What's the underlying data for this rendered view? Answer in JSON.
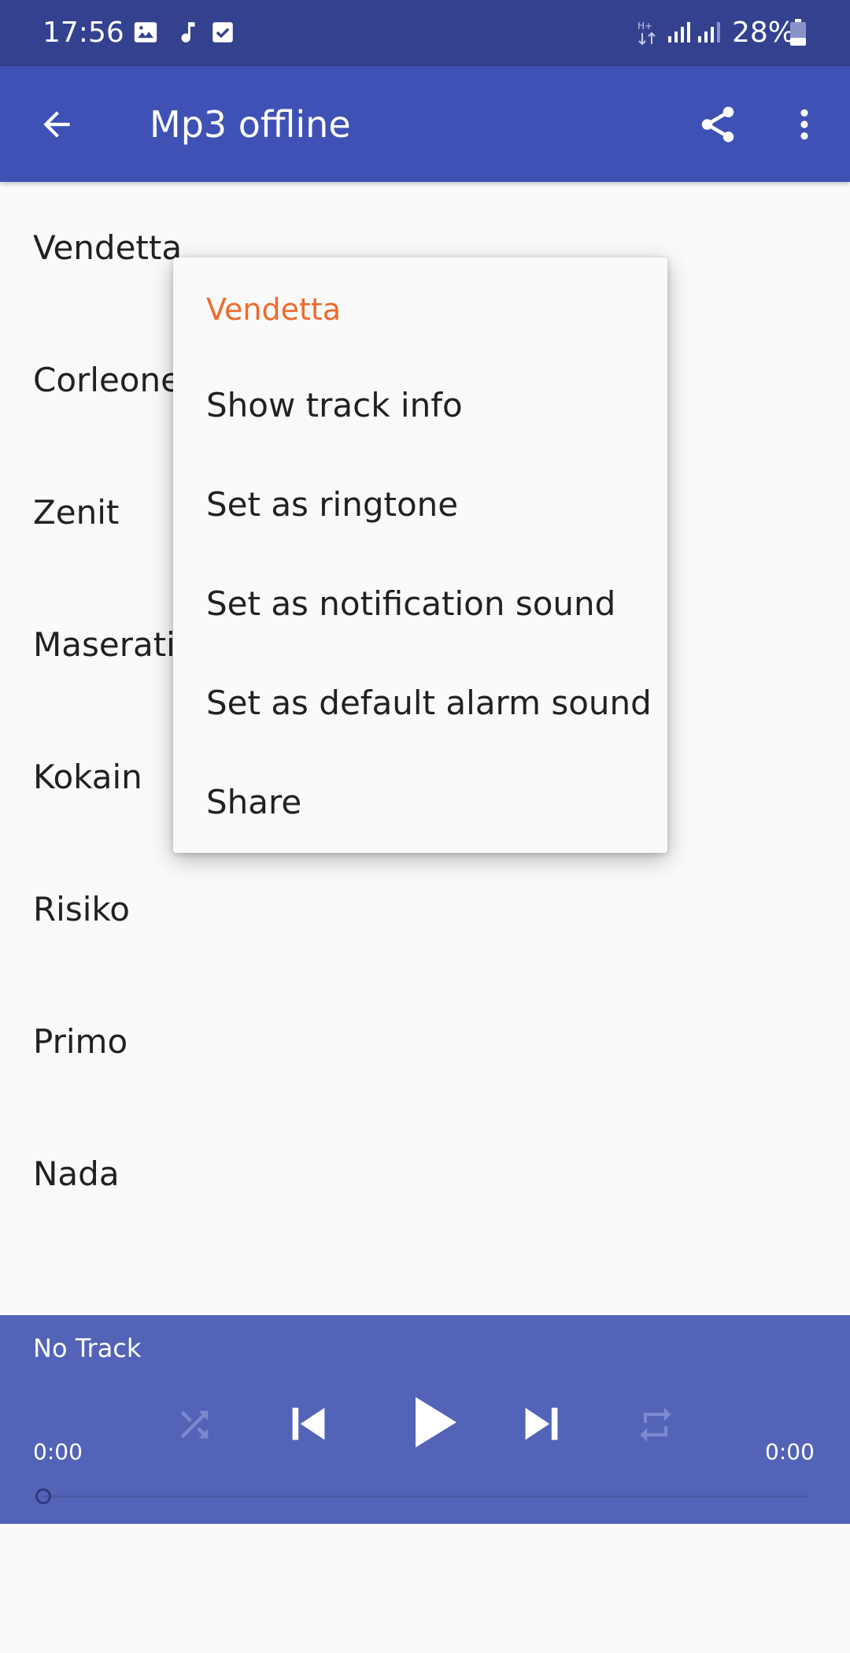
{
  "status_bar": {
    "time": "17:56",
    "battery": "28%",
    "icons": [
      "image-icon",
      "music-note-icon",
      "checkbox-icon",
      "data-hplus-icon",
      "signal-icon",
      "signal-icon",
      "battery-icon"
    ]
  },
  "app_bar": {
    "title": "Mp3 offline",
    "icons": [
      "back-arrow-icon",
      "share-icon",
      "more-vert-icon"
    ]
  },
  "tracks": [
    "Vendetta",
    "Corleone",
    "Zenit",
    "Maserati",
    "Kokain",
    "Risiko",
    "Primo",
    "Nada"
  ],
  "context_menu": {
    "title": "Vendetta",
    "items": [
      "Show track info",
      "Set as ringtone",
      "Set as notification sound",
      "Set as default alarm sound",
      "Share"
    ]
  },
  "player": {
    "now_playing": "No Track",
    "elapsed": "0:00",
    "duration": "0:00",
    "progress": 0,
    "icons": [
      "shuffle-icon",
      "skip-previous-icon",
      "play-icon",
      "skip-next-icon",
      "repeat-icon"
    ]
  },
  "colors": {
    "status_bar": "#34418f",
    "app_bar": "#3f51b5",
    "player": "#5363b8",
    "menu_title": "#f06a2c",
    "background": "#fafafa"
  }
}
